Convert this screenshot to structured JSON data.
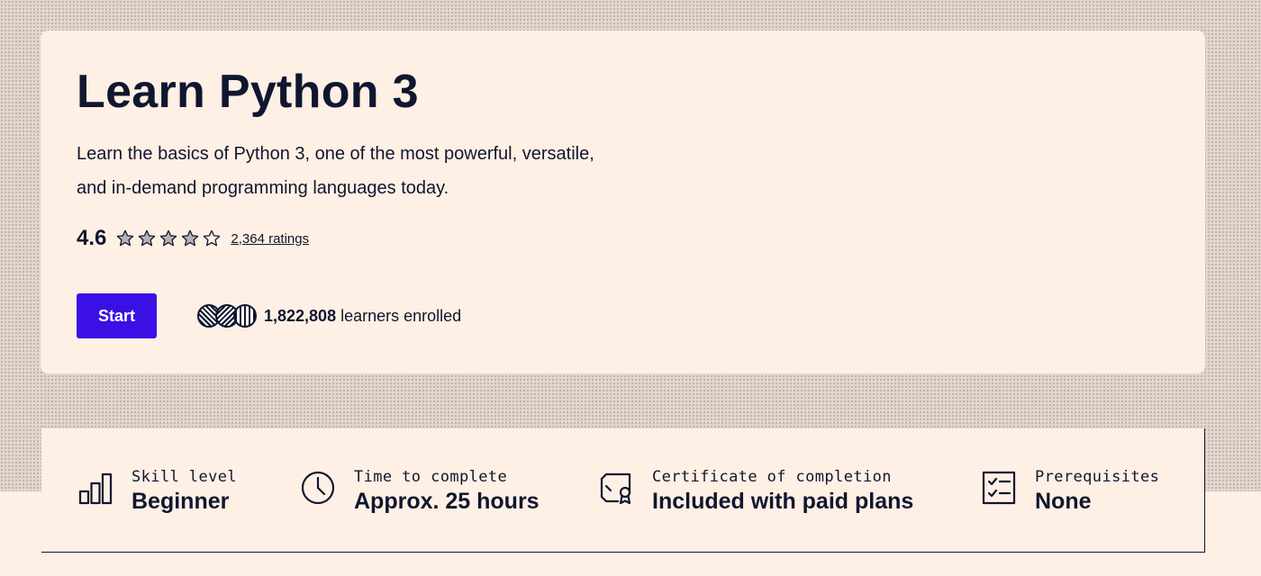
{
  "course": {
    "title": "Learn Python 3",
    "description": "Learn the basics of Python 3, one of the most powerful, versatile, and in-demand programming languages today.",
    "rating": {
      "value": "4.6",
      "stars_filled": 4.6,
      "stars_max": 5,
      "count_label": "2,364 ratings"
    },
    "start_label": "Start",
    "enrolled": {
      "count": "1,822,808",
      "suffix": " learners enrolled"
    }
  },
  "details": [
    {
      "icon": "bar-chart-icon",
      "label": "Skill level",
      "value": "Beginner"
    },
    {
      "icon": "clock-icon",
      "label": "Time to complete",
      "value": "Approx. 25 hours"
    },
    {
      "icon": "certificate-icon",
      "label": "Certificate of completion",
      "value": "Included with paid plans"
    },
    {
      "icon": "checklist-icon",
      "label": "Prerequisites",
      "value": "None"
    }
  ],
  "colors": {
    "primary": "#3a10e5",
    "text": "#10162f",
    "background": "#fff0e5"
  }
}
